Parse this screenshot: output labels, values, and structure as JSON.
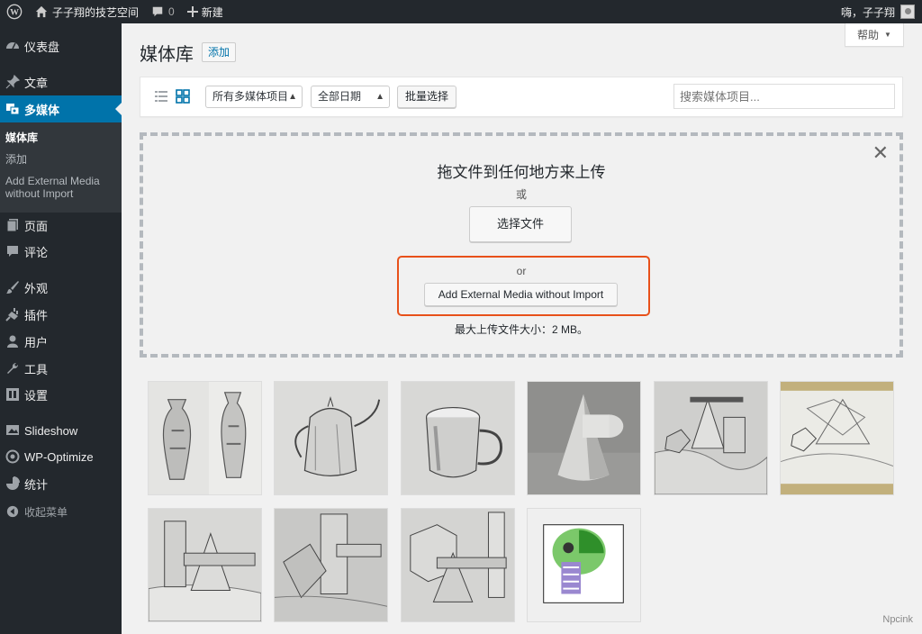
{
  "adminbar": {
    "site_name": "子子翔的技艺空间",
    "comments_count": "0",
    "new_label": "新建",
    "greeting": "嗨，子子翔"
  },
  "sidebar": {
    "items": [
      {
        "label": "仪表盘",
        "icon": "dashboard-icon"
      },
      {
        "label": "文章",
        "icon": "pin-icon"
      },
      {
        "label": "多媒体",
        "icon": "media-icon"
      },
      {
        "label": "页面",
        "icon": "page-icon"
      },
      {
        "label": "评论",
        "icon": "comment-icon"
      },
      {
        "label": "外观",
        "icon": "brush-icon"
      },
      {
        "label": "插件",
        "icon": "plugin-icon"
      },
      {
        "label": "用户",
        "icon": "user-icon"
      },
      {
        "label": "工具",
        "icon": "wrench-icon"
      },
      {
        "label": "设置",
        "icon": "settings-icon"
      },
      {
        "label": "Slideshow",
        "icon": "slideshow-icon"
      },
      {
        "label": "WP-Optimize",
        "icon": "optimize-icon"
      },
      {
        "label": "统计",
        "icon": "stats-icon"
      },
      {
        "label": "收起菜单",
        "icon": "collapse-icon"
      }
    ],
    "submenu": {
      "library": "媒体库",
      "add": "添加",
      "external": "Add External Media without Import"
    }
  },
  "main": {
    "help": "帮助",
    "title": "媒体库",
    "add_new": "添加",
    "filter_type": "所有多媒体项目",
    "filter_date": "全部日期",
    "bulk_select": "批量选择",
    "search_placeholder": "搜索媒体项目..."
  },
  "uploader": {
    "drop_title": "拖文件到任何地方来上传",
    "or1": "或",
    "select_files": "选择文件",
    "or2": "or",
    "external_button": "Add External Media without Import",
    "max_size": "最大上传文件大小：2 MB。"
  },
  "colors": {
    "accent": "#0073aa",
    "highlight": "#e8511a",
    "sidebar": "#23282d"
  },
  "watermark": "Npcink"
}
